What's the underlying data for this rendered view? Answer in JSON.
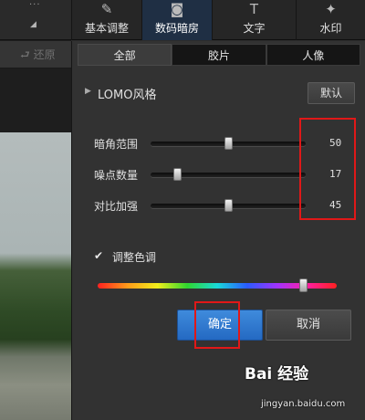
{
  "left": {
    "menu_dots": "···",
    "undo_label": "还原"
  },
  "toolbar": {
    "tools": [
      {
        "label": "基本调整",
        "icon": "adjust-icon"
      },
      {
        "label": "数码暗房",
        "icon": "darkroom-icon",
        "active": true
      },
      {
        "label": "文字",
        "icon": "text-icon"
      },
      {
        "label": "水印",
        "icon": "watermark-icon"
      }
    ]
  },
  "tabs": [
    {
      "label": "全部",
      "active": true
    },
    {
      "label": "胶片"
    },
    {
      "label": "人像"
    }
  ],
  "preset": {
    "name": "LOMO风格",
    "default_button": "默认"
  },
  "sliders": [
    {
      "label": "暗角范围",
      "value": "50"
    },
    {
      "label": "噪点数量",
      "value": "17"
    },
    {
      "label": "对比加强",
      "value": "45"
    }
  ],
  "color_adjust": {
    "label": "调整色调",
    "checked": true,
    "hue_position": 0.86
  },
  "buttons": {
    "ok": "确定",
    "cancel": "取消"
  },
  "watermark": {
    "brand": "Bai 经验",
    "url": "jingyan.baidu.com"
  },
  "colors": {
    "accent": "#2f78d0",
    "highlight_box": "#e01818"
  }
}
